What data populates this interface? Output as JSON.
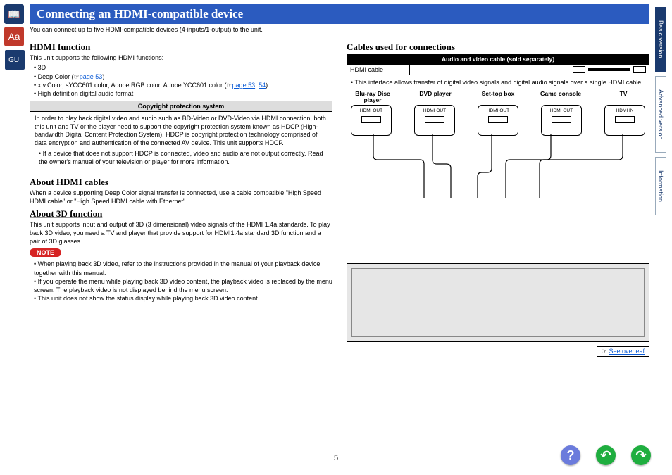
{
  "title": "Connecting an HDMI-compatible device",
  "intro": "You can connect up to five HDMI-compatible devices (4-inputs/1-output) to the unit.",
  "page_number": "5",
  "left": {
    "h_function": "HDMI function",
    "func_intro": "This unit supports the following HDMI functions:",
    "func_items": {
      "i1": "3D",
      "i2_pre": "Deep Color (",
      "i2_link": "page 53",
      "i2_post": ")",
      "i3_pre": "x.v.Color, sYCC601 color, Adobe RGB color, Adobe YCC601 color (",
      "i3_link1": "page 53",
      "i3_sep": ", ",
      "i3_link2": "54",
      "i3_post": ")",
      "i4": "High definition digital audio format"
    },
    "cps_header": "Copyright protection system",
    "cps_body1": "In order to play back digital video and audio such as BD-Video or DVD-Video via HDMI connection, both this unit and TV or the player need to support the copyright protection system known as HDCP (High-bandwidth Digital Content Protection System). HDCP is copyright protection technology comprised of data encryption and authentication of the connected AV device. This unit supports HDCP.",
    "cps_body2": "If a device that does not support HDCP is connected, video and audio are not output correctly. Read the owner's manual of your television or player for more information.",
    "h_cables": "About HDMI cables",
    "cables_body": "When a device supporting Deep Color signal transfer is connected, use a cable compatible \"High Speed HDMI cable\" or \"High Speed HDMI cable with Ethernet\".",
    "h_3d": "About 3D function",
    "d3_body": "This unit supports input and output of 3D (3 dimensional) video signals of the HDMI 1.4a standards. To play back 3D video, you need a TV and player that provide support for HDMI1.4a standard 3D function and a pair of 3D glasses.",
    "note_label": "NOTE",
    "note_items": {
      "n1": "When playing back 3D video, refer to the instructions provided in the manual of your playback device together with this manual.",
      "n2": "If you operate the menu while playing back 3D video content, the playback video is replaced by the menu screen. The playback video is not displayed behind the menu screen.",
      "n3": "This unit does not show the status display while playing back 3D video content."
    }
  },
  "right": {
    "h_conn": "Cables used for connections",
    "table_header": "Audio and video cable (sold separately)",
    "row_label": "HDMI cable",
    "iface_note": "This interface allows transfer of digital video signals and digital audio signals over a single HDMI cable.",
    "devices": {
      "d1": "Blu-ray Disc player",
      "d2": "DVD player",
      "d3": "Set-top box",
      "d4": "Game console",
      "d5": "TV"
    },
    "port_out": "HDMI OUT",
    "port_in": "HDMI IN",
    "overleaf_pre": "☞",
    "overleaf": "See overleaf"
  },
  "tabs": {
    "t1": "Basic version",
    "t2": "Advanced version",
    "t3": "Information"
  },
  "rail": {
    "book": "📖",
    "aa": "Aa",
    "gui": "GUI"
  }
}
